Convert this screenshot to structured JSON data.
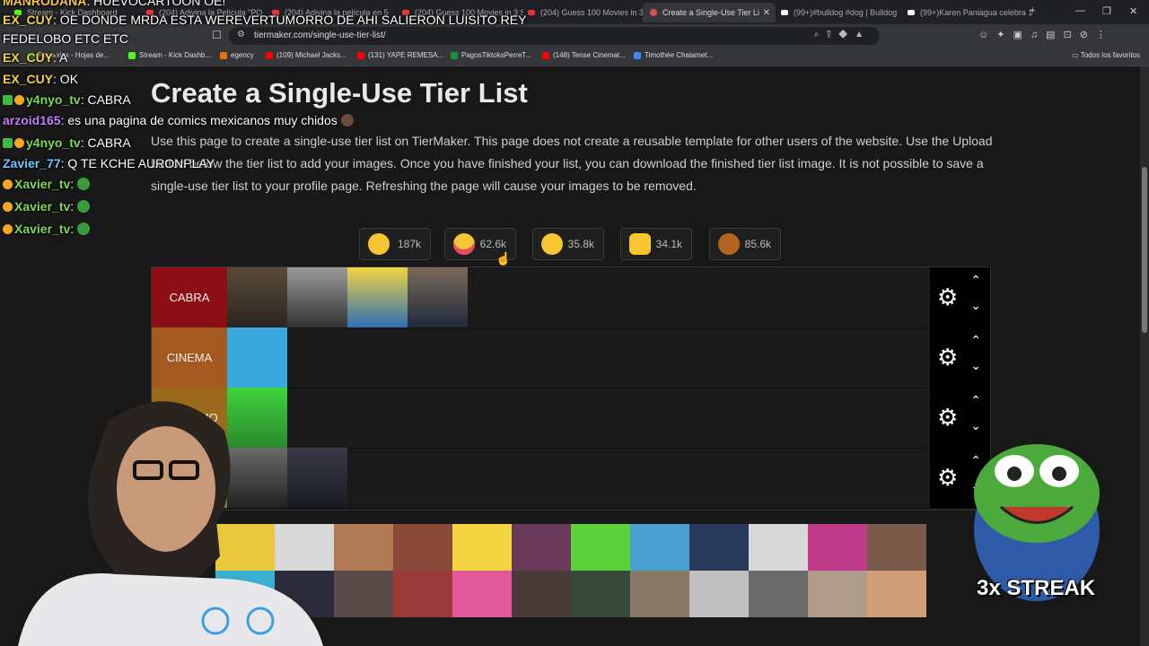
{
  "browser": {
    "tabs": [
      {
        "label": "Stream - Kick Dashboard",
        "icon": "kick-icon"
      },
      {
        "label": "(204) Adivina la Película \"POR",
        "icon": "youtube-icon"
      },
      {
        "label": "(204) Adivina la película en 5 s",
        "icon": "youtube-icon"
      },
      {
        "label": "(204) Guess 100 Movies in 3 Se",
        "icon": "youtube-icon"
      },
      {
        "label": "Create a Single-Use Tier Li",
        "icon": "tiermaker-icon",
        "active": true
      },
      {
        "label": "(99+)#bulldog #dog | Bulldog",
        "icon": "tiktok-icon"
      },
      {
        "label": "(99+)Karen Paniagua celebra 1",
        "icon": "tiktok-icon"
      }
    ],
    "url": "tiermaker.com/single-use-tier-list/",
    "bookmarks": [
      {
        "label": "Pepe.xlsx - Hojas de...",
        "color": "#1e8e3e"
      },
      {
        "label": "Stream - Kick Dashb...",
        "color": "#53fc18"
      },
      {
        "label": "egency",
        "color": "#e8710a"
      },
      {
        "label": "(109) Michael Jacks...",
        "color": "#ff0000"
      },
      {
        "label": "(131) YAPE REMESA...",
        "color": "#ff0000"
      },
      {
        "label": "PagosTiktoksPerreT...",
        "color": "#1e8e3e"
      },
      {
        "label": "(148) Tense Cinemat...",
        "color": "#ff0000"
      },
      {
        "label": "Timothée Chalamet...",
        "color": "#4285f4"
      }
    ],
    "favorites_label": "Todos los favoritos"
  },
  "page": {
    "title": "Create a Single-Use Tier List",
    "description": "Use this page to create a single-use tier list on TierMaker. This page does not create a reusable template for other users of the website. Use the Upload button below the tier list to add your images. Once you have finished your list, you can download the finished tier list image. It is not possible to save a single-use tier list to your profile page. Refreshing the page will cause your images to be removed.",
    "reactions": [
      {
        "count": "187k",
        "emoji": "grin",
        "color": "#f7c531"
      },
      {
        "count": "62.6k",
        "emoji": "heart-eyes",
        "color": "#f7c531"
      },
      {
        "count": "35.8k",
        "emoji": "laughing",
        "color": "#f7c531"
      },
      {
        "count": "34.1k",
        "emoji": "raised-hands",
        "color": "#f7c531"
      },
      {
        "count": "85.6k",
        "emoji": "poop",
        "color": "#b5651d"
      }
    ],
    "tiers": [
      {
        "label": "CABRA",
        "color": "#8b0f14",
        "items": 4
      },
      {
        "label": "CINEMA",
        "color": "#a4591f",
        "items": 1
      },
      {
        "label": "MALISIMO",
        "color": "#9c6a1c",
        "items": 1
      },
      {
        "label": "",
        "color": "#8c7a20",
        "items": 2
      }
    ],
    "pool_items": 24
  },
  "chat": [
    {
      "user": "MANRODANA",
      "msg": ": HUEVOCARTOON OE!",
      "color": "#f5c542"
    },
    {
      "user": "EX_CUY",
      "msg": ": OE DONDE MRDA ESTA WEREVERTUMORRO DE AHI SALIERON LUISITO REY",
      "color": "#f5d142"
    },
    {
      "user": "",
      "msg": "FEDELOBO ETC ETC",
      "color": "#ffffff"
    },
    {
      "user": "EX_CUY",
      "msg": ": A",
      "color": "#f5d142"
    },
    {
      "user": "EX_CUY",
      "msg": ": OK",
      "color": "#f5d142"
    },
    {
      "user": "y4nyo_tv",
      "msg": ": CABRA",
      "color": "#7ed957",
      "badges": true
    },
    {
      "user": "arzoid165",
      "msg": ": es una pagina de comics mexicanos muy chidos",
      "color": "#c77dff"
    },
    {
      "user": "y4nyo_tv",
      "msg": ": CABRA",
      "color": "#7ed957",
      "badges": true
    },
    {
      "user": "Zavier_77",
      "msg": ": Q TE KCHE AURONPLAY",
      "color": "#6ec6ff"
    },
    {
      "user": "Xavier_tv",
      "msg": ":",
      "color": "#7ed957",
      "badges": true
    },
    {
      "user": "Xavier_tv",
      "msg": ":",
      "color": "#7ed957",
      "badges": true
    },
    {
      "user": "Xavier_tv",
      "msg": ":",
      "color": "#7ed957",
      "badges": true
    }
  ],
  "overlay": {
    "streak_text": "3x STREAK"
  }
}
